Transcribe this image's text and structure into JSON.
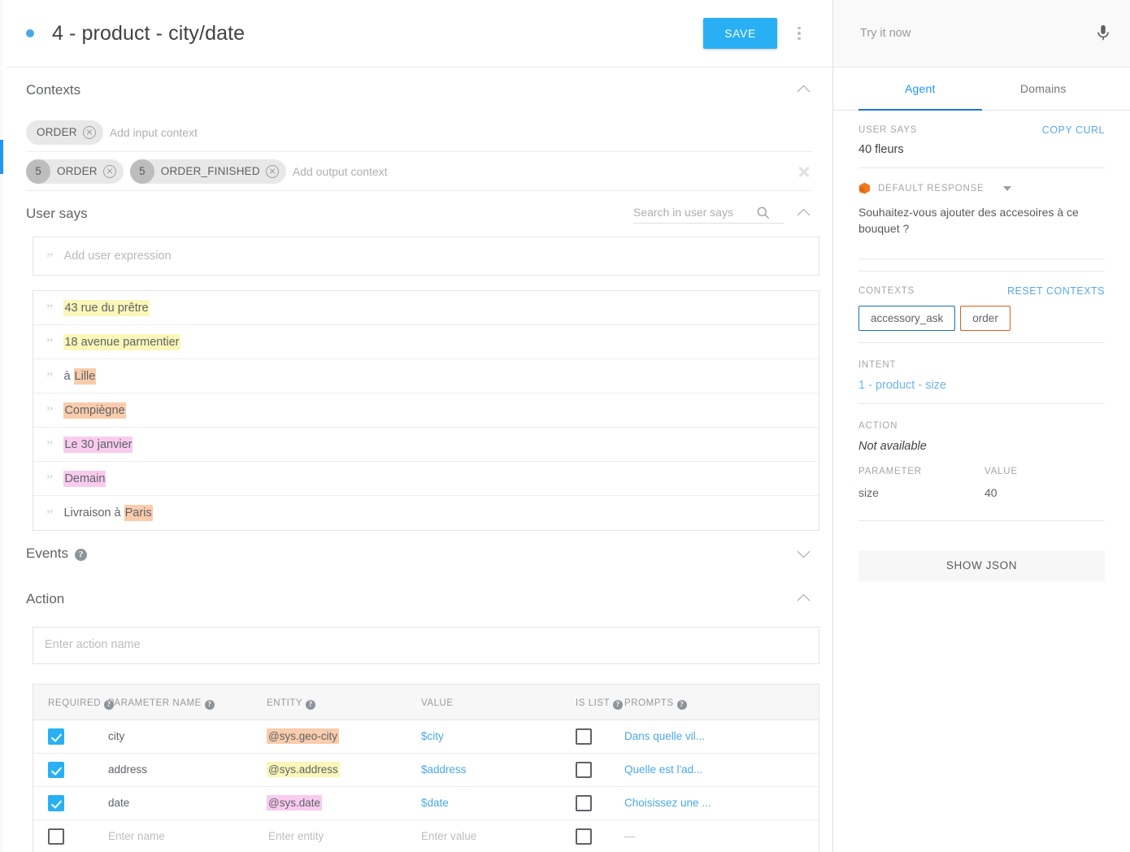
{
  "header": {
    "status_dot": "status-dot",
    "title": "4 - product - city/date",
    "save_label": "SAVE",
    "menu_icon": "more-vert-icon"
  },
  "contexts": {
    "section_title": "Contexts",
    "input": {
      "chips": [
        {
          "label": "ORDER"
        }
      ],
      "placeholder": "Add input context"
    },
    "output": {
      "chips": [
        {
          "count": "5",
          "label": "ORDER"
        },
        {
          "count": "5",
          "label": "ORDER_FINISHED"
        }
      ],
      "placeholder": "Add output context"
    }
  },
  "user_says": {
    "section_title": "User says",
    "search_placeholder": "Search in user says",
    "add_placeholder": "Add user expression",
    "rows": [
      {
        "parts": [
          {
            "text": "43 rue du prêtre",
            "hl": "yellow"
          }
        ]
      },
      {
        "parts": [
          {
            "text": "18 avenue parmentier",
            "hl": "yellow"
          }
        ]
      },
      {
        "parts": [
          {
            "text": "à ",
            "hl": ""
          },
          {
            "text": "Lille",
            "hl": "orange"
          }
        ]
      },
      {
        "parts": [
          {
            "text": "Compiègne",
            "hl": "orange"
          }
        ]
      },
      {
        "parts": [
          {
            "text": "Le 30 janvier",
            "hl": "pink"
          }
        ]
      },
      {
        "parts": [
          {
            "text": "Demain",
            "hl": "pink"
          }
        ]
      },
      {
        "parts": [
          {
            "text": "Livraison à ",
            "hl": ""
          },
          {
            "text": "Paris",
            "hl": "orange"
          }
        ]
      }
    ]
  },
  "events": {
    "section_title": "Events"
  },
  "action": {
    "section_title": "Action",
    "name_placeholder": "Enter action name",
    "columns": {
      "required": "REQUIRED",
      "parameter_name": "PARAMETER NAME",
      "entity": "ENTITY",
      "value": "VALUE",
      "is_list": "IS LIST",
      "prompts": "PROMPTS"
    },
    "rows": [
      {
        "required": true,
        "name": "city",
        "entity": "@sys.geo-city",
        "entity_hl": "orange",
        "value": "$city",
        "is_list": false,
        "prompts": "Dans quelle vil..."
      },
      {
        "required": true,
        "name": "address",
        "entity": "@sys.address",
        "entity_hl": "yellow",
        "value": "$address",
        "is_list": false,
        "prompts": "Quelle est l'ad..."
      },
      {
        "required": true,
        "name": "date",
        "entity": "@sys.date",
        "entity_hl": "pink",
        "value": "$date",
        "is_list": false,
        "prompts": "Choisissez une ..."
      },
      {
        "required": false,
        "name": "Enter name",
        "entity": "Enter entity",
        "entity_hl": "",
        "value": "Enter value",
        "is_list": false,
        "prompts": "—",
        "is_new": true
      }
    ]
  },
  "right_panel": {
    "try_placeholder": "Try it now",
    "mic_icon": "microphone-icon",
    "tabs": [
      {
        "label": "Agent",
        "active": true
      },
      {
        "label": "Domains",
        "active": false
      }
    ],
    "user_says_label": "USER SAYS",
    "copy_curl_label": "COPY CURL",
    "user_says_value": "40 fleurs",
    "default_response_label": "DEFAULT RESPONSE",
    "default_response_icon": "cube-icon",
    "default_response_text": "Souhaitez-vous ajouter des accesoires à ce bouquet ?",
    "contexts_label": "CONTEXTS",
    "reset_contexts_label": "RESET CONTEXTS",
    "context_chips": [
      {
        "label": "accessory_ask",
        "color": "blue"
      },
      {
        "label": "order",
        "color": "orange"
      }
    ],
    "intent_label": "INTENT",
    "intent_value": "1 - product - size",
    "action_label": "ACTION",
    "action_value": "Not available",
    "parameter_label": "PARAMETER",
    "value_label": "VALUE",
    "parameters": [
      {
        "name": "size",
        "value": "40"
      }
    ],
    "show_json_label": "SHOW JSON"
  },
  "colors": {
    "accent": "#29b0f4",
    "highlight_yellow": "#faf7b8",
    "highlight_orange": "#f9ccab",
    "highlight_pink": "#f9cbef",
    "tab_active": "#2196f3",
    "context_blue": "#1b6fb5",
    "context_orange": "#e05c1f"
  }
}
